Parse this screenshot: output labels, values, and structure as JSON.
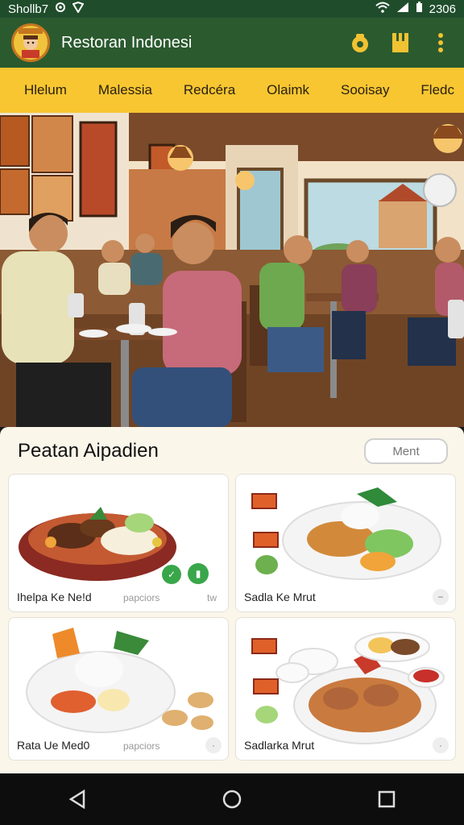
{
  "status": {
    "carrier": "Shollb7",
    "time": "2306"
  },
  "app": {
    "title": "Restoran Indonesi"
  },
  "tabs": [
    "Hlelum",
    "Malessia",
    "Redcéra",
    "Olaimk",
    "Sooisay",
    "Fledc"
  ],
  "section": {
    "title": "Peatan Aipadien",
    "button": "Ment"
  },
  "dishes": [
    {
      "name": "Ihelpa Ke Ne!d",
      "meta": "papciors",
      "extra": "tw"
    },
    {
      "name": "Sadla Ke Mrut",
      "meta": "",
      "extra": ""
    },
    {
      "name": "Rata Ue Med0",
      "meta": "papciors",
      "extra": ""
    },
    {
      "name": "Sadlarka Mrut",
      "meta": "",
      "extra": ""
    }
  ],
  "colors": {
    "appbar": "#2b5a2f",
    "tabs": "#f7c631",
    "panel": "#fbf6ea",
    "accent_green": "#3aa64a"
  }
}
